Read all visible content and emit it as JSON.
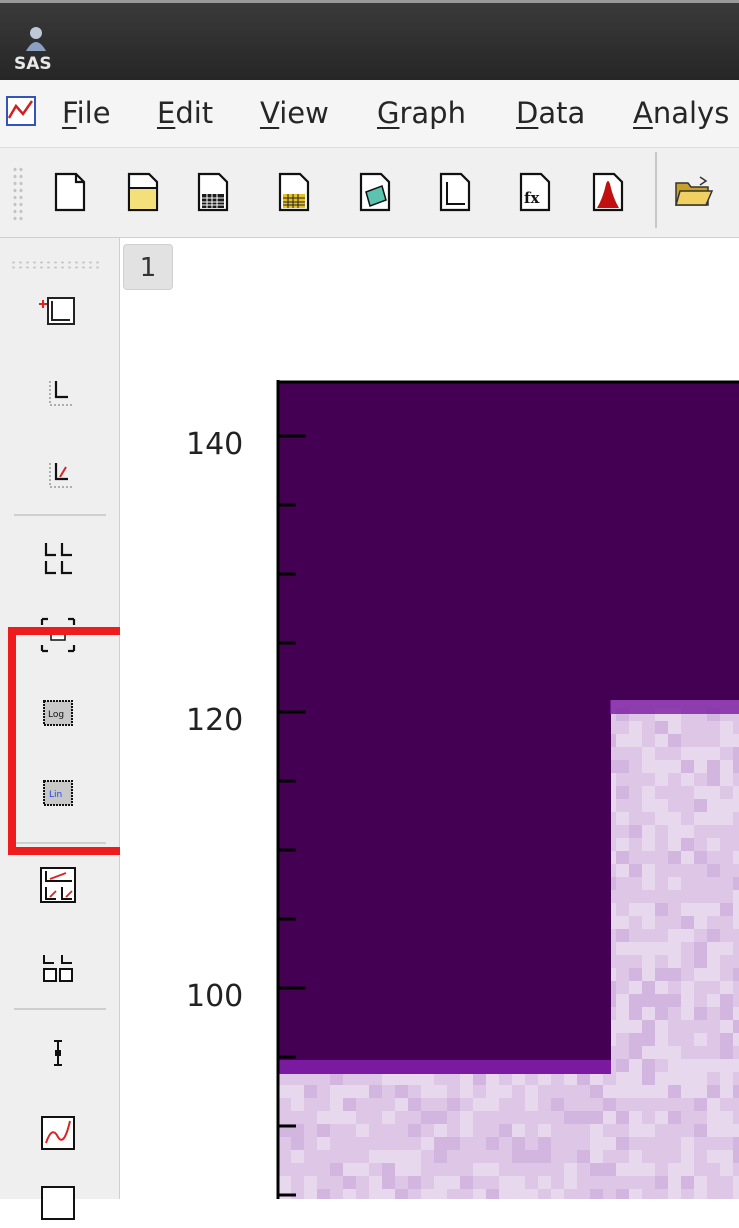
{
  "app": {
    "logo_text": "SAS"
  },
  "menu": {
    "items": [
      {
        "mnemonic": "F",
        "rest": "ile"
      },
      {
        "mnemonic": "E",
        "rest": "dit"
      },
      {
        "mnemonic": "V",
        "rest": "iew"
      },
      {
        "mnemonic": "G",
        "rest": "raph"
      },
      {
        "mnemonic": "D",
        "rest": "ata"
      },
      {
        "mnemonic": "A",
        "rest": "nalys"
      }
    ]
  },
  "toolbar": {
    "icons": [
      "new-file-icon",
      "open-folder-icon",
      "table-icon",
      "yellow-table-icon",
      "data-view-icon",
      "plot-icon",
      "fx-function-icon",
      "histogram-icon",
      "open-icon"
    ]
  },
  "tabs": [
    "1"
  ],
  "plot": {
    "y_ticks": [
      "140",
      "120",
      "100"
    ],
    "colors": {
      "dark": "#440154",
      "light": "#ddc6e6",
      "edge": "#7a1aa0"
    }
  }
}
